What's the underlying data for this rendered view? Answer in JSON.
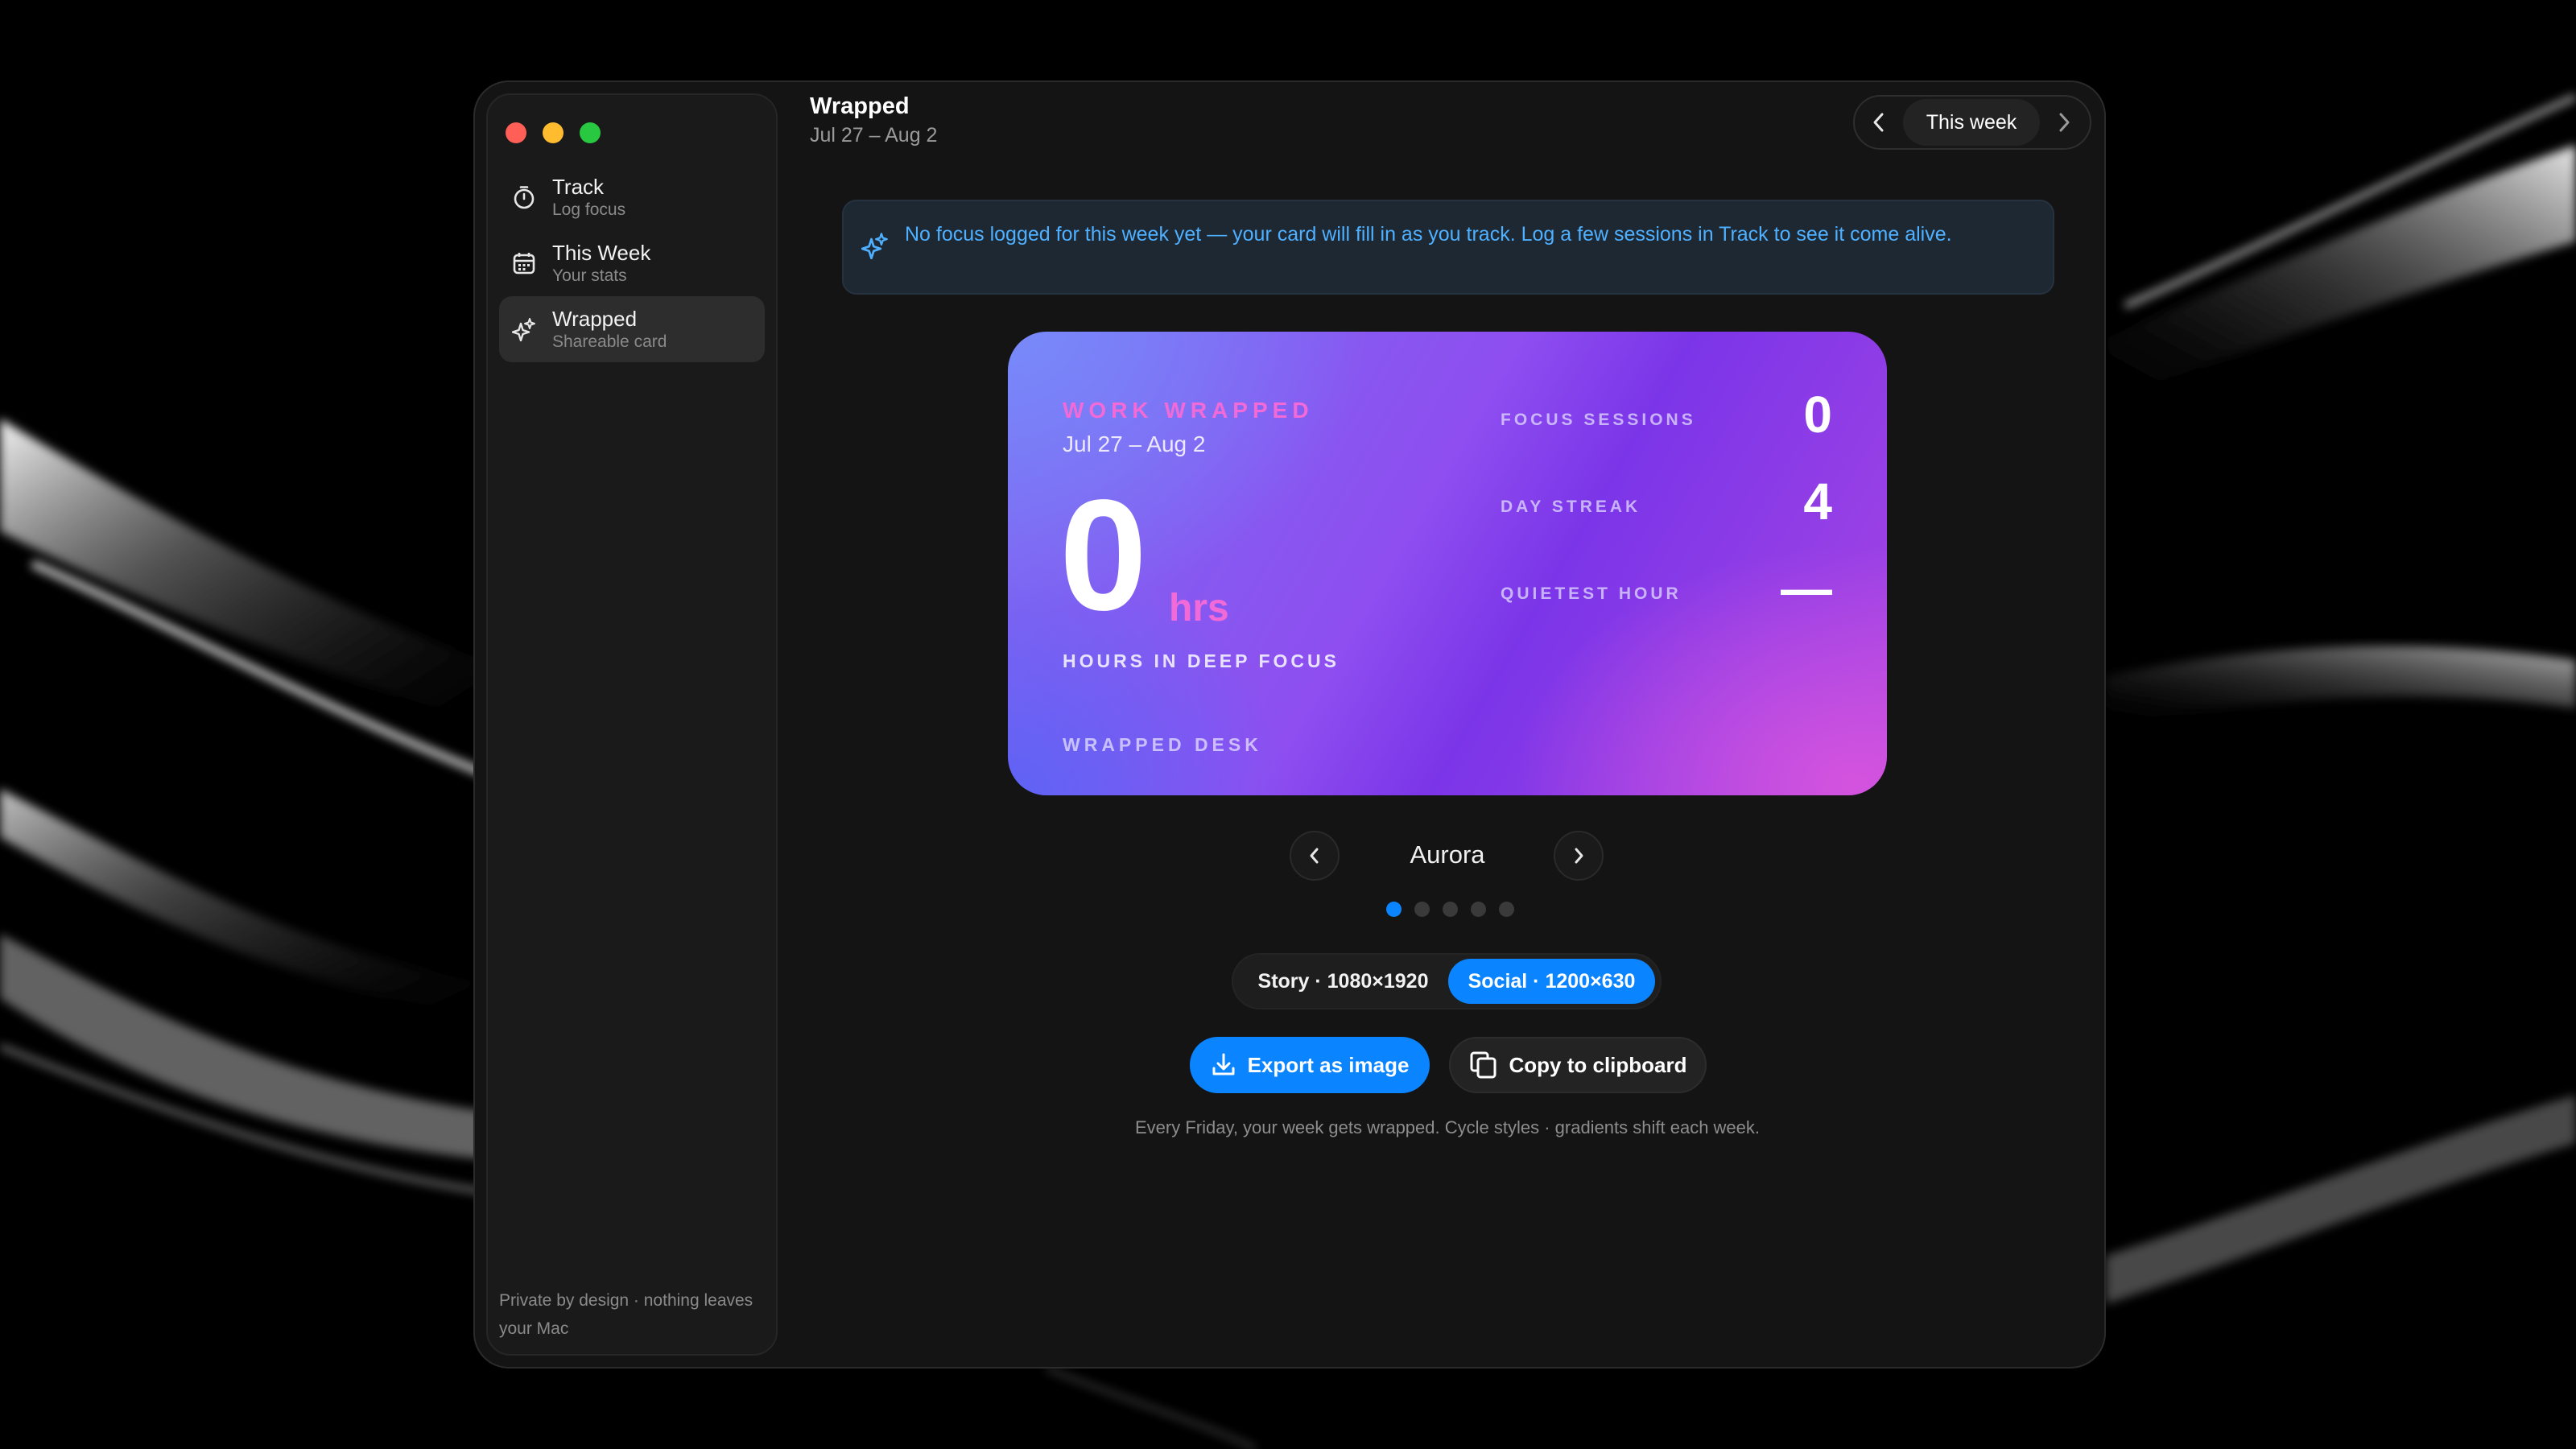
{
  "sidebar": {
    "items": [
      {
        "label": "Track",
        "sub": "Log focus",
        "icon": "stopwatch-icon"
      },
      {
        "label": "This Week",
        "sub": "Your stats",
        "icon": "calendar-icon"
      },
      {
        "label": "Wrapped",
        "sub": "Shareable card",
        "icon": "sparkles-icon",
        "active": true
      }
    ],
    "footer": "Private by design · nothing leaves your Mac"
  },
  "header": {
    "title": "Wrapped",
    "date_range": "Jul 27 – Aug 2",
    "week_nav": {
      "label": "This week"
    }
  },
  "banner": {
    "icon": "sparkles-icon",
    "text": "No focus logged for this week yet — your card will fill in as you track. Log a few sessions in Track to see it come alive."
  },
  "card": {
    "eyebrow": "WORK WRAPPED",
    "dates": "Jul 27 – Aug 2",
    "hours": "0",
    "unit": "hrs",
    "caption": "HOURS IN DEEP FOCUS",
    "brand": "WRAPPED DESK",
    "stats": [
      {
        "label": "FOCUS SESSIONS",
        "value": "0"
      },
      {
        "label": "DAY STREAK",
        "value": "4"
      },
      {
        "label": "QUIETEST HOUR",
        "value": "—"
      }
    ]
  },
  "style_picker": {
    "name": "Aurora",
    "count": 5,
    "active_index": 0
  },
  "size_toggle": {
    "options": [
      "Story · 1080×1920",
      "Social · 1200×630"
    ],
    "selected": "Social · 1200×630"
  },
  "actions": {
    "export_label": "Export as image",
    "copy_label": "Copy to clipboard"
  },
  "footnote": "Every Friday, your week gets wrapped. Cycle styles · gradients shift each week.",
  "colors": {
    "accent": "#0a84ff",
    "card_pink": "#f26ad8",
    "banner_text": "#4fb0ff"
  }
}
